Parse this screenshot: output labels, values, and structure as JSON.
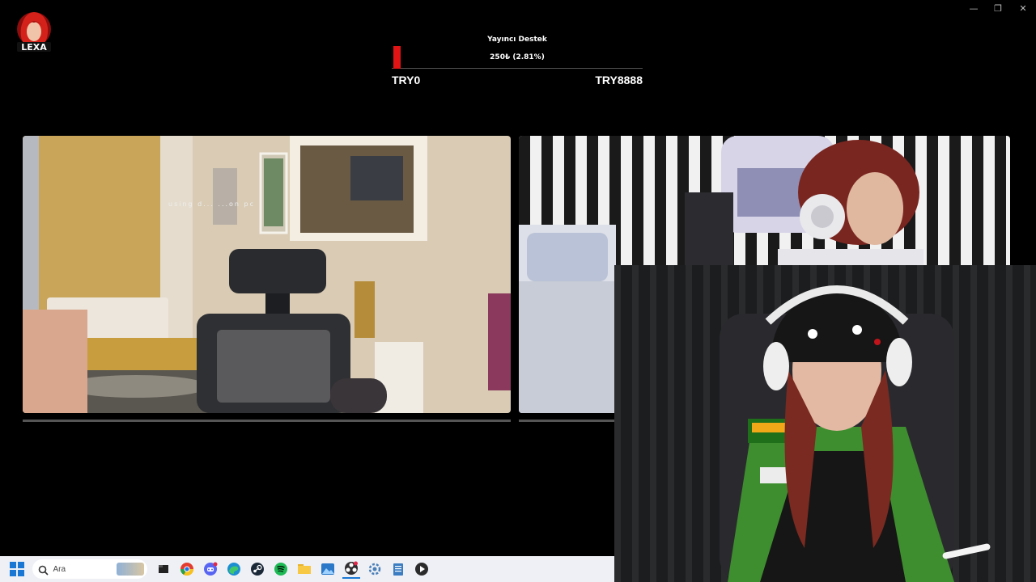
{
  "window_controls": [
    "—",
    "❐",
    "✕"
  ],
  "overlay": {
    "logo_text": "LEXA",
    "goal": {
      "title": "Yayıncı Destek",
      "amount_text": "250₺ (2.81%)",
      "min_label": "TRY0",
      "max_label": "TRY8888",
      "progress_percent": 2.81,
      "bar_color": "#e01414"
    }
  },
  "cameras": [
    {
      "name": "room-camera",
      "overlay_text": "using d... ...on pc"
    },
    {
      "name": "guest-camera"
    },
    {
      "name": "streamer-camera"
    }
  ],
  "taskbar": {
    "search_placeholder": "Ara",
    "apps": [
      "start-icon",
      "search-icon",
      "file-explorer-icon",
      "chrome-icon",
      "discord-icon",
      "edge-icon",
      "steam-icon",
      "spotify-icon",
      "folder-icon",
      "photos-icon",
      "obs-icon",
      "settings-icon",
      "notepad-icon",
      "media-player-icon"
    ]
  }
}
